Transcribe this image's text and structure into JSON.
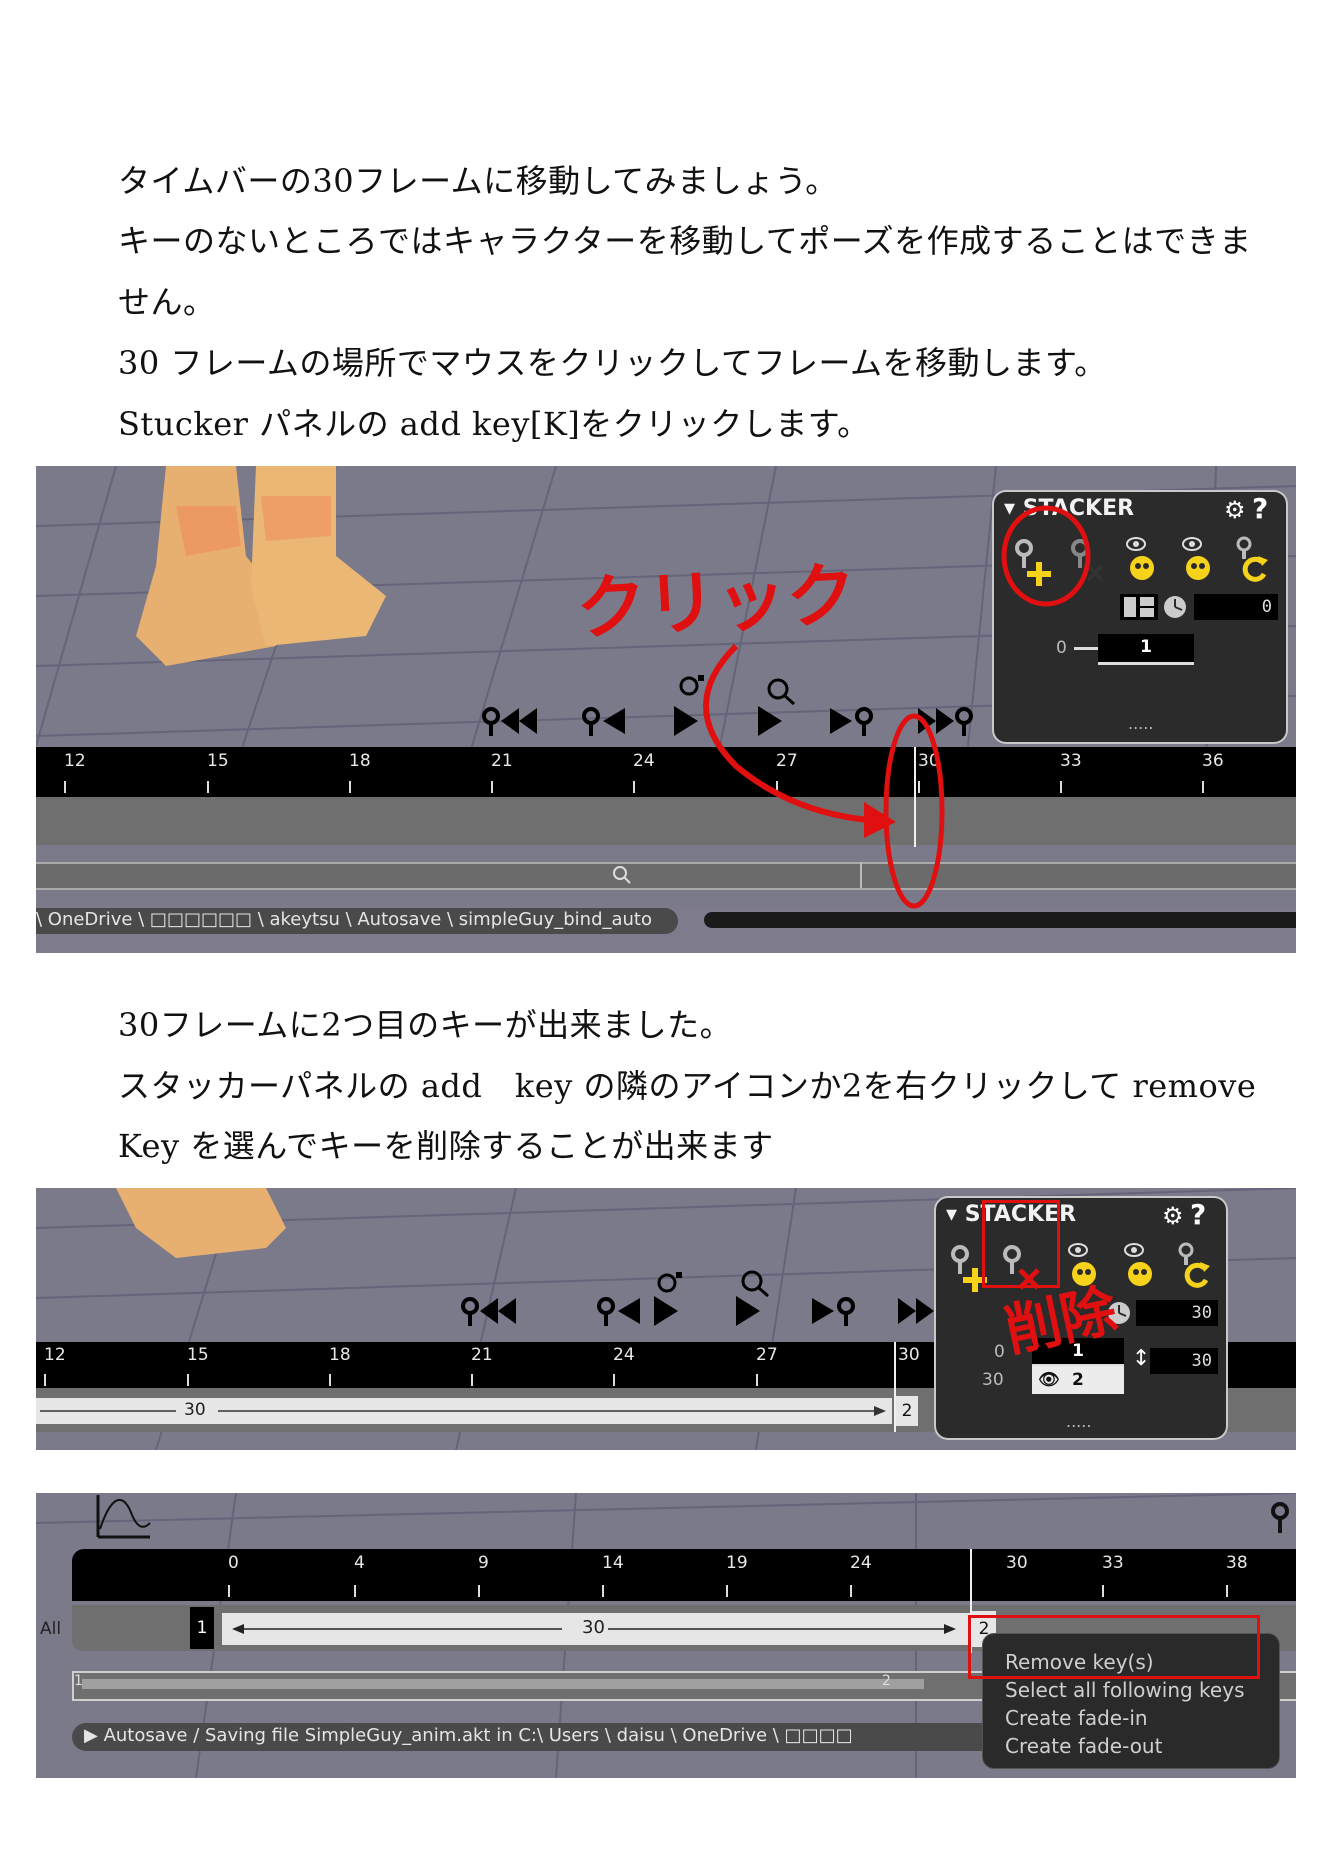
{
  "section1": {
    "lines": [
      "タイムバーの30フレームに移動してみましょう。",
      "キーのないところではキャラクターを移動してポーズを作成することはできま",
      "せん。",
      "30 フレームの場所でマウスをクリックしてフレームを移動します。",
      "Stucker パネルの add key[K]をクリックします。"
    ]
  },
  "shot1": {
    "ticks": [
      "12",
      "15",
      "18",
      "21",
      "24",
      "27",
      "30",
      "33",
      "36"
    ],
    "stacker_title": "STACKER",
    "time_value": "0",
    "key_frame": "0",
    "key_number": "1",
    "annotation": "クリック",
    "status_path": "\\ OneDrive \\ □□□□□□ \\ akeytsu \\ Autosave \\ simpleGuy_bind_auto",
    "grip": "....."
  },
  "section2": {
    "lines": [
      "30フレームに2つ目のキーが出来ました。",
      "スタッカーパネルの add　key の隣のアイコンか2を右クリックして remove",
      "Key を選んでキーを削除することが出来ます"
    ]
  },
  "shot2": {
    "ticks": [
      "12",
      "15",
      "18",
      "21",
      "24",
      "27",
      "30"
    ],
    "stacker_title": "STACKER",
    "time_value": "30",
    "key1_frame": "0",
    "key1_number": "1",
    "key2_frame": "30",
    "key2_number": "2",
    "duration": "30",
    "span_label": "30",
    "key_marker": "2",
    "annotation": "削除",
    "grip": "....."
  },
  "shot3": {
    "ticks": [
      "0",
      "4",
      "9",
      "14",
      "19",
      "24",
      "30",
      "33",
      "38"
    ],
    "track_label": "All",
    "key1": "1",
    "span_label": "30",
    "key2": "2",
    "mini_key1": "1",
    "mini_key2": "2",
    "menu_items": [
      "Remove key(s)",
      "Select all following keys",
      "Create fade-in",
      "Create fade-out"
    ],
    "status_text": "▶ Autosave / Saving file SimpleGuy_anim.akt in C:\\ Users \\ daisu \\ OneDrive \\ □□□□",
    "colors": {
      "annotation": "#e01010",
      "key_active": "#000000"
    }
  }
}
